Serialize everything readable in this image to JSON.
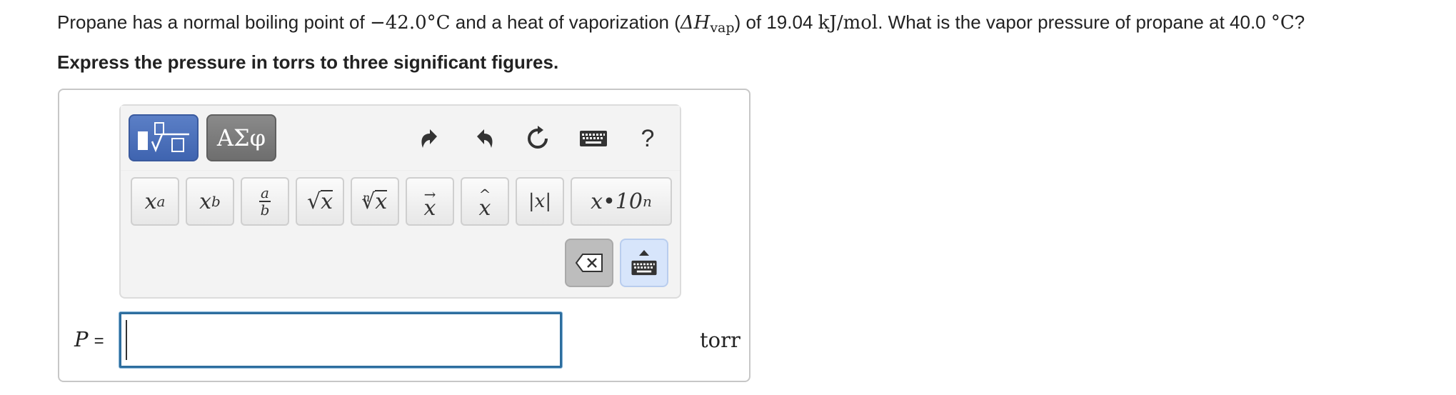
{
  "question": {
    "part1": "Propane has a normal boiling point of ",
    "bp_value": "−42.0°",
    "bp_unit": "C",
    "part2": " and a heat of vaporization (",
    "delta_h": "ΔH",
    "delta_sub": "vap",
    "part3": ") of 19.04 ",
    "hv_unit": "kJ/mol",
    "part4": ". What is the vapor pressure of propane at 40.0 ",
    "temp_unit": "°C",
    "part5": "?"
  },
  "instruction": "Express the pressure in torrs to three significant figures.",
  "toolbar": {
    "greek_label": "ΑΣφ",
    "help_label": "?",
    "symbols": {
      "power_base": "x",
      "power_exp": "a",
      "sub_base": "x",
      "sub_idx": "b",
      "frac_num": "a",
      "frac_den": "b",
      "sqrt_arg": "x",
      "nroot_idx": "n",
      "nroot_arg": "x",
      "vec": "x",
      "hat": "x",
      "abs": "|x|",
      "sci_base": "x•10",
      "sci_exp": "n"
    }
  },
  "answer": {
    "variable": "P",
    "equals": "=",
    "value": "",
    "unit": "torr"
  },
  "colors": {
    "accent": "#3f64b0",
    "input_border": "#2e6e9e"
  }
}
